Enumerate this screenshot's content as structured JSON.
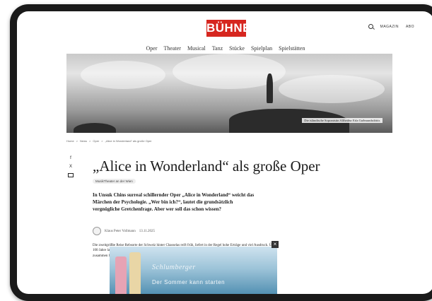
{
  "header": {
    "logo": "BÜHNE",
    "magazine": "MAGAZIN",
    "abo": "ABO"
  },
  "nav": [
    "Oper",
    "Theater",
    "Musical",
    "Tanz",
    "Stücke",
    "Spielplan",
    "Spielstätten"
  ],
  "hero": {
    "caption": "Die isländische Sopranistin Alfheiður Erla Guðmundsdóttir."
  },
  "breadcrumb": [
    "Home",
    ">",
    "News",
    ">",
    "Oper",
    ">",
    "„Alice in Wonderland“ als große Oper"
  ],
  "social": {
    "facebook": "f",
    "x": "X"
  },
  "article": {
    "title": "„Alice in Wonderland“ als große Oper",
    "tag": "MusikTheater an der Wien",
    "lead": "In Unsuk Chins surreal schillernder Oper „Alice in Wonderland“ weicht das Märchen der Psychologie. „Wer bin ich?“, lautet die grundsätzlich vergnügliche Gretchenfrage. Aber wer soll das schon wissen?",
    "author": "Klaus Peter Vollmann",
    "date": "13.11.2025",
    "body": "Die zweitgrößte Reise Rebsorte der Schweiz hinter Chasselas reift früh, liefert in der Regel hohe Erträge und viel Ausdruck. Über 100 Jahre lang ging man davon aus, dass sie aus Riesling und Silvaner, bis 2000 gezeigt wurde, dass es sich um andere Rebsorten zusammen handelt."
  },
  "ad": {
    "brand": "Schlumberger",
    "slogan": "Der Sommer kann starten",
    "close": "×"
  }
}
